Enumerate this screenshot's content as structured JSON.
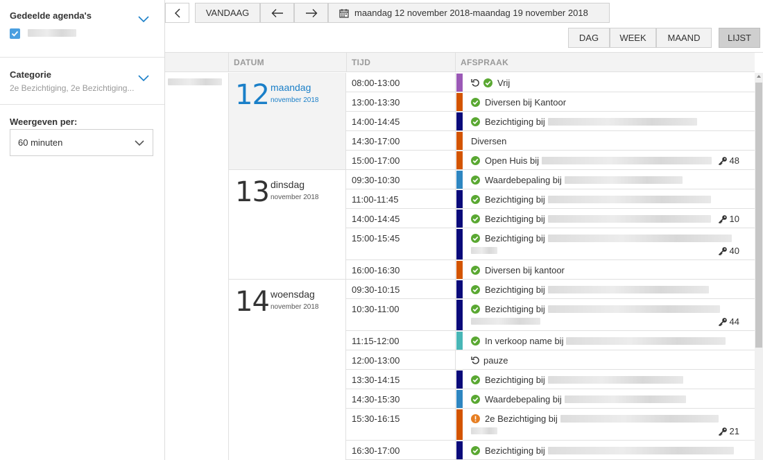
{
  "sidebar": {
    "shared_calendars_title": "Gedeelde agenda's",
    "category_title": "Categorie",
    "category_value": "2e Bezichtiging, 2e Bezichtiging...",
    "display_per_title": "Weergeven per:",
    "display_per_value": "60 minuten"
  },
  "toolbar": {
    "today_label": "VANDAAG",
    "date_range": "maandag 12 november 2018-maandag 19 november 2018",
    "views": [
      "DAG",
      "WEEK",
      "MAAND",
      "LIJST"
    ],
    "active_view": "LIJST"
  },
  "table": {
    "headers": {
      "date": "DATUM",
      "time": "TIJD",
      "appointment": "AFSPRAAK"
    },
    "days": [
      {
        "num": "12",
        "name": "maandag",
        "month": "november 2018",
        "today": true
      },
      {
        "num": "13",
        "name": "dinsdag",
        "month": "november 2018",
        "today": false
      },
      {
        "num": "14",
        "name": "woensdag",
        "month": "november 2018",
        "today": false
      }
    ],
    "rows": [
      {
        "time": "08:00-13:00",
        "text": "Vrij",
        "color": "#9b59b6",
        "icons": [
          "repeat",
          "check"
        ],
        "key": ""
      },
      {
        "time": "13:00-13:30",
        "text": "Diversen bij Kantoor",
        "color": "#d35400",
        "icons": [
          "check"
        ],
        "key": ""
      },
      {
        "time": "14:00-14:45",
        "text": "Bezichtiging bij",
        "color": "#0a0a7a",
        "icons": [
          "check"
        ],
        "key": ""
      },
      {
        "time": "14:30-17:00",
        "text": "Diversen",
        "color": "#d35400",
        "icons": [],
        "key": ""
      },
      {
        "time": "15:00-17:00",
        "text": "Open Huis bij",
        "color": "#d35400",
        "icons": [
          "check"
        ],
        "key": "48"
      },
      {
        "time": "09:30-10:30",
        "text": "Waardebepaling bij",
        "color": "#2e86c1",
        "icons": [
          "check"
        ],
        "key": ""
      },
      {
        "time": "11:00-11:45",
        "text": "Bezichtiging bij",
        "color": "#0a0a7a",
        "icons": [
          "check"
        ],
        "key": ""
      },
      {
        "time": "14:00-14:45",
        "text": "Bezichtiging bij",
        "color": "#0a0a7a",
        "icons": [
          "check"
        ],
        "key": "10"
      },
      {
        "time": "15:00-15:45",
        "text": "Bezichtiging bij",
        "color": "#0a0a7a",
        "icons": [
          "check"
        ],
        "key": "40"
      },
      {
        "time": "16:00-16:30",
        "text": "Diversen bij kantoor",
        "color": "#d35400",
        "icons": [
          "check"
        ],
        "key": ""
      },
      {
        "time": "09:30-10:15",
        "text": "Bezichtiging bij",
        "color": "#0a0a7a",
        "icons": [
          "check"
        ],
        "key": ""
      },
      {
        "time": "10:30-11:00",
        "text": "Bezichtiging bij",
        "color": "#0a0a7a",
        "icons": [
          "check"
        ],
        "key": "44"
      },
      {
        "time": "11:15-12:00",
        "text": "In verkoop name bij",
        "color": "#48b6b6",
        "icons": [
          "check"
        ],
        "key": ""
      },
      {
        "time": "12:00-13:00",
        "text": "pauze",
        "color": "",
        "icons": [
          "repeat"
        ],
        "key": ""
      },
      {
        "time": "13:30-14:15",
        "text": "Bezichtiging bij",
        "color": "#0a0a7a",
        "icons": [
          "check"
        ],
        "key": ""
      },
      {
        "time": "14:30-15:30",
        "text": "Waardebepaling bij",
        "color": "#2e86c1",
        "icons": [
          "check"
        ],
        "key": ""
      },
      {
        "time": "15:30-16:15",
        "text": "2e Bezichtiging bij",
        "color": "#d35400",
        "icons": [
          "warning"
        ],
        "key": "21"
      },
      {
        "time": "16:30-17:00",
        "text": "Bezichtiging bij",
        "color": "#0a0a7a",
        "icons": [
          "check"
        ],
        "key": ""
      }
    ]
  },
  "colors": {
    "accent": "#1a7fc8",
    "check": "#5aa832",
    "warning": "#e67e22",
    "checkbox": "#4a9fe0"
  }
}
